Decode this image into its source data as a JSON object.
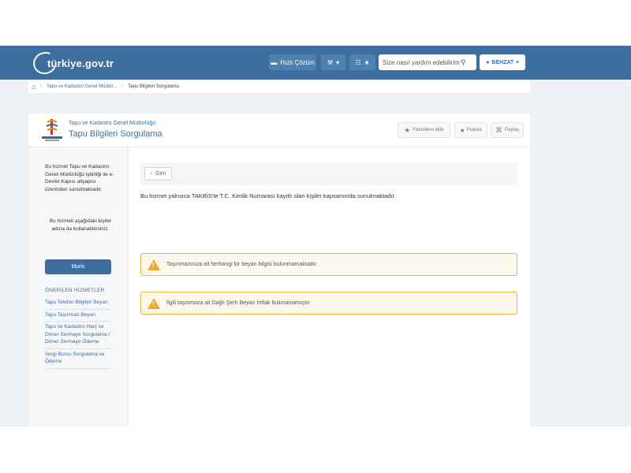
{
  "header": {
    "logo_text": "türkiye.gov.tr",
    "hizli_cozum": "Hızlı Çözüm",
    "search_placeholder": "Size nasıl yardım edebilirim?",
    "user_name": "BEHZAT"
  },
  "breadcrumb": {
    "items": [
      "Tapu ve Kadastro Genel Müdürl...",
      "Tapu Bilgileri Sorgulama"
    ]
  },
  "service": {
    "agency": "Tapu ve Kadastro Genel Müdürlüğü",
    "title": "Tapu Bilgileri Sorgulama",
    "actions": {
      "favorite": "Favorilere ekle",
      "rate": "Puanla",
      "share": "Paylaş"
    }
  },
  "sidebar": {
    "note": "Bu hizmet Tapu ve Kadastro Genel Müdürlüğü işbirliği ile e-Devlet Kapısı altyapısı üzerinden sunulmaktadır.",
    "usage": "Bu hizmeti aşağıdaki kişiler adına da kullanabilirsiniz.",
    "muris_button": "Muris",
    "recommended_title": "ÖNERİLEN HİZMETLER",
    "recommended": [
      "Tapu Telefon Bilgileri Beyan",
      "Tapu Taşınmaz Beyan",
      "Tapu ve Kadastro Harç ve Döner Sermaye Sorgulama / Döner Sermaye Ödeme",
      "Vergi Borcu Sorgulama ve Ödeme"
    ]
  },
  "main": {
    "back_button": "Geri",
    "info_text": "Bu hizmet yalnızca TAKBİS'te T.C. Kimlik Numarası kayıtlı olan kişiler kapsamında sunulmaktadır.",
    "warnings": [
      "Taşınmazınıza ait herhangi bir beyan bilgisi bulunmamaktadır.",
      "İlgili taşınmaza ait Dağlı Şerh Beyan İrtifak bulunamamıştır."
    ]
  }
}
